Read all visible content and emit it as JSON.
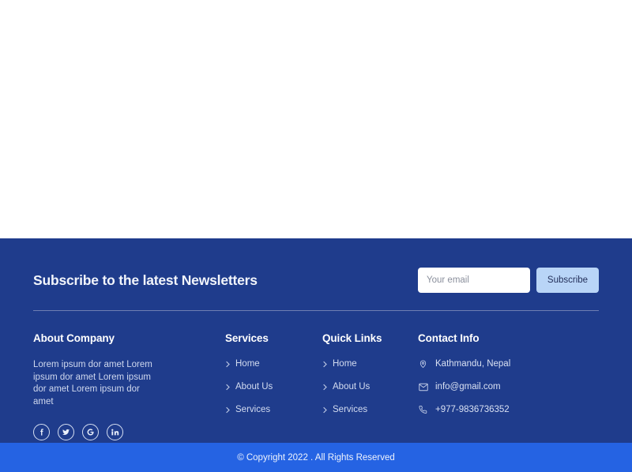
{
  "colors": {
    "footer_bg": "#1f3c8c",
    "copyright_bg": "#2563e3",
    "button_bg": "#b9d5f7",
    "button_text": "#24305a",
    "divider": "#6f7fb3",
    "body_text": "#cfd8ee"
  },
  "newsletter": {
    "title": "Subscribe to the latest Newsletters",
    "email_placeholder": "Your email",
    "email_value": "",
    "subscribe_label": "Subscribe"
  },
  "about": {
    "title": "About Company",
    "text": "Lorem ipsum dor amet Lorem ipsum dor amet Lorem ipsum dor amet Lorem ipsum dor amet",
    "socials": [
      {
        "name": "facebook",
        "label": "Facebook"
      },
      {
        "name": "twitter",
        "label": "Twitter"
      },
      {
        "name": "google",
        "label": "Google"
      },
      {
        "name": "linkedin",
        "label": "LinkedIn"
      }
    ]
  },
  "services": {
    "title": "Services",
    "links": [
      {
        "label": "Home"
      },
      {
        "label": "About Us"
      },
      {
        "label": "Services"
      }
    ]
  },
  "quick_links": {
    "title": "Quick Links",
    "links": [
      {
        "label": "Home"
      },
      {
        "label": "About Us"
      },
      {
        "label": "Services"
      }
    ]
  },
  "contact": {
    "title": "Contact Info",
    "items": [
      {
        "icon": "map-pin-icon",
        "label": "Kathmandu, Nepal"
      },
      {
        "icon": "envelope-icon",
        "label": "info@gmail.com"
      },
      {
        "icon": "phone-icon",
        "label": "+977-9836736352"
      }
    ]
  },
  "copyright": {
    "text": "© Copyright 2022 . All Rights Reserved"
  }
}
